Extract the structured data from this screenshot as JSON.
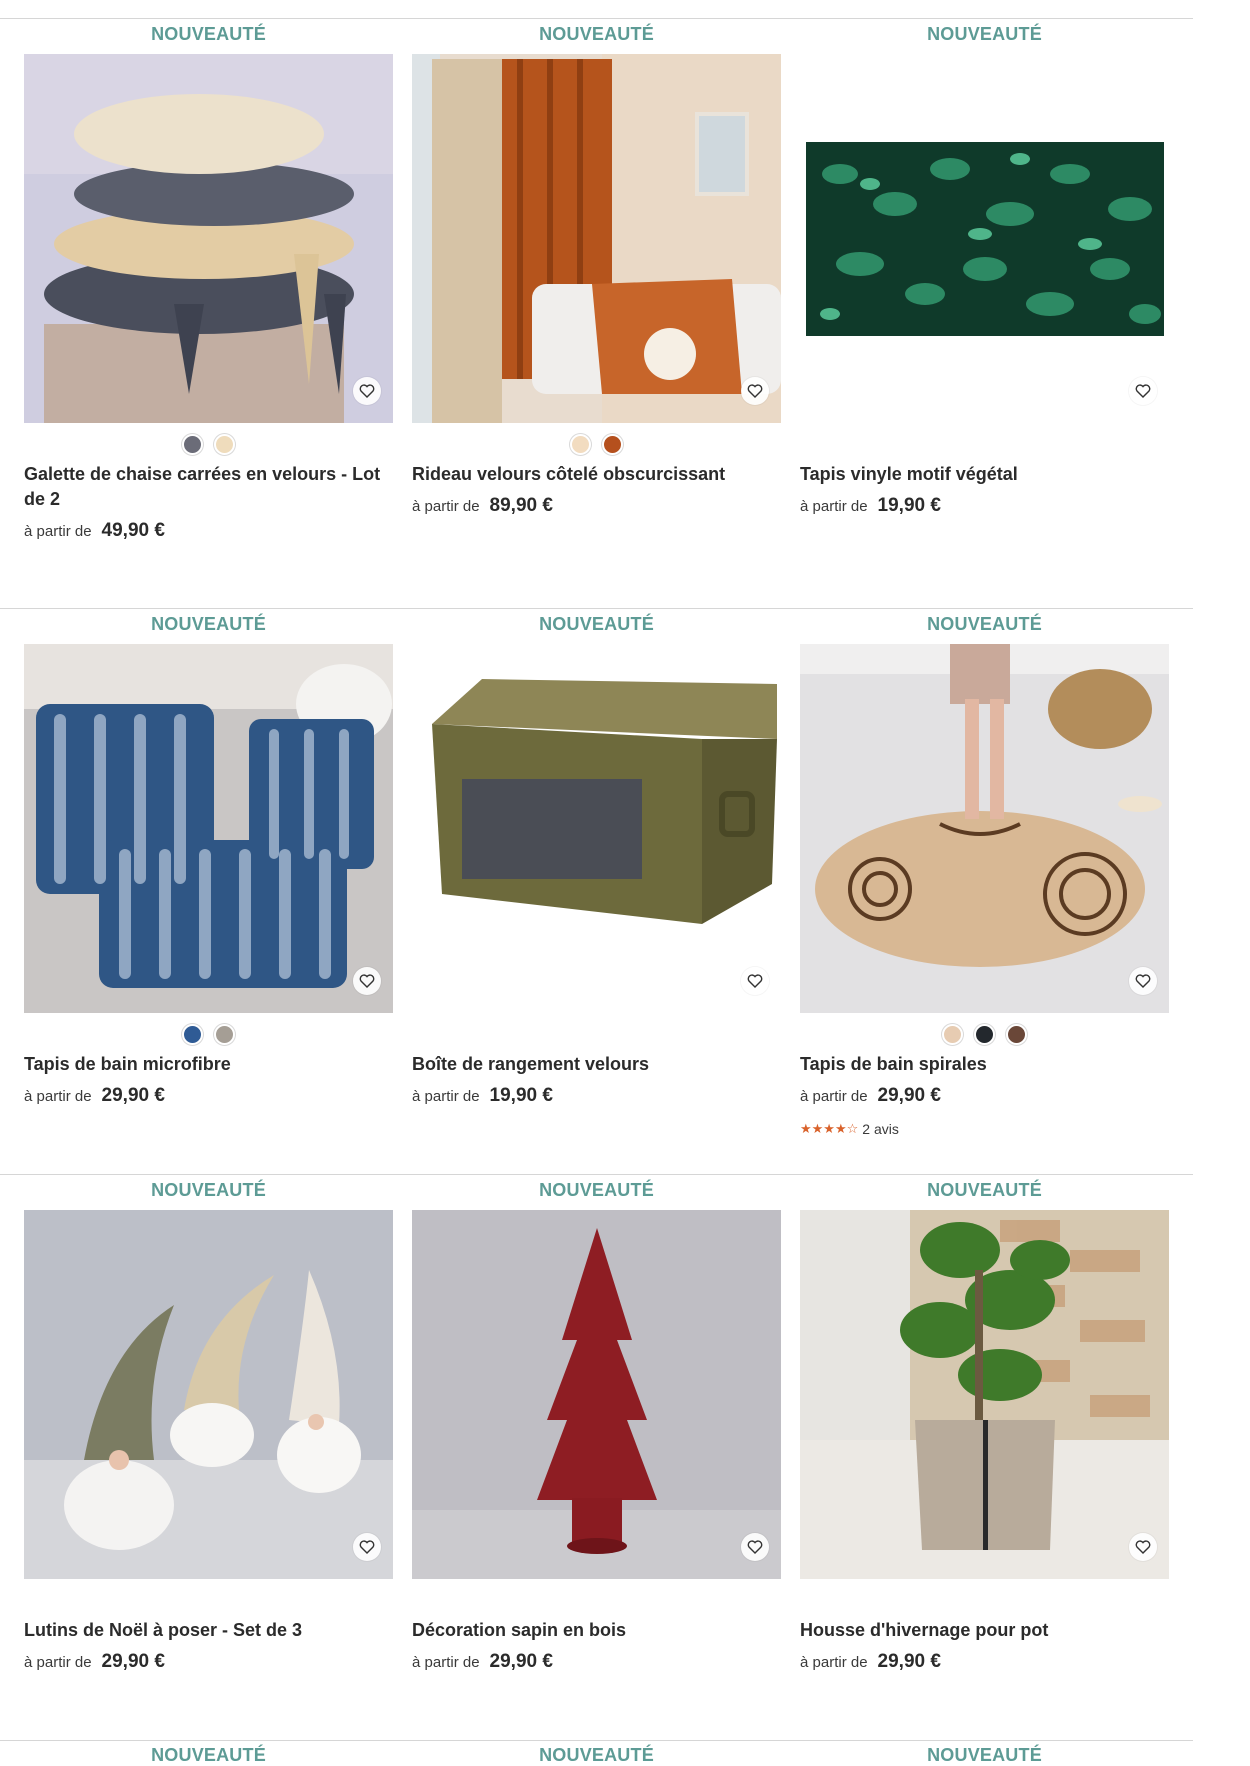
{
  "products": [
    {
      "badge": "NOUVEAUTÉ",
      "title": "Galette de chaise carrées en velours - Lot de 2",
      "from_label": "à partir de",
      "price": "49,90 €",
      "swatches": [
        "#6b6c78",
        "#efdcbc"
      ],
      "image_icon": "chair-cushions-image"
    },
    {
      "badge": "NOUVEAUTÉ",
      "title": "Rideau velours côtelé obscurcissant",
      "from_label": "à partir de",
      "price": "89,90 €",
      "swatches": [
        "#f2dcc0",
        "#b5501d"
      ],
      "image_icon": "curtain-image"
    },
    {
      "badge": "NOUVEAUTÉ",
      "title": "Tapis vinyle motif végétal",
      "from_label": "à partir de",
      "price": "19,90 €",
      "swatches": [],
      "image_icon": "vinyl-rug-image"
    },
    {
      "badge": "NOUVEAUTÉ",
      "title": "Tapis de bain microfibre",
      "from_label": "à partir de",
      "price": "29,90 €",
      "swatches": [
        "#2f5b95",
        "#a59e95"
      ],
      "image_icon": "bath-mat-set-image"
    },
    {
      "badge": "NOUVEAUTÉ",
      "title": "Boîte de rangement velours",
      "from_label": "à partir de",
      "price": "19,90 €",
      "swatches": [],
      "image_icon": "storage-box-image"
    },
    {
      "badge": "NOUVEAUTÉ",
      "title": "Tapis de bain spirales",
      "from_label": "à partir de",
      "price": "29,90 €",
      "swatches": [
        "#e7ccb2",
        "#23282d",
        "#6a4738"
      ],
      "rating_stars": "★★★★☆",
      "rating_value": 4,
      "reviews": "2 avis",
      "image_icon": "round-bath-mat-image"
    },
    {
      "badge": "NOUVEAUTÉ",
      "title": "Lutins de Noël à poser - Set de 3",
      "from_label": "à partir de",
      "price": "29,90 €",
      "swatches": [],
      "image_icon": "christmas-gnomes-image"
    },
    {
      "badge": "NOUVEAUTÉ",
      "title": "Décoration sapin en bois",
      "from_label": "à partir de",
      "price": "29,90 €",
      "swatches": [],
      "image_icon": "wooden-tree-image"
    },
    {
      "badge": "NOUVEAUTÉ",
      "title": "Housse d'hivernage pour pot",
      "from_label": "à partir de",
      "price": "29,90 €",
      "swatches": [],
      "image_icon": "pot-cover-image"
    }
  ],
  "next_row_badges": [
    "NOUVEAUTÉ",
    "NOUVEAUTÉ",
    "NOUVEAUTÉ"
  ],
  "colors": {
    "badge": "#5d9b95",
    "star": "#d9622b"
  }
}
